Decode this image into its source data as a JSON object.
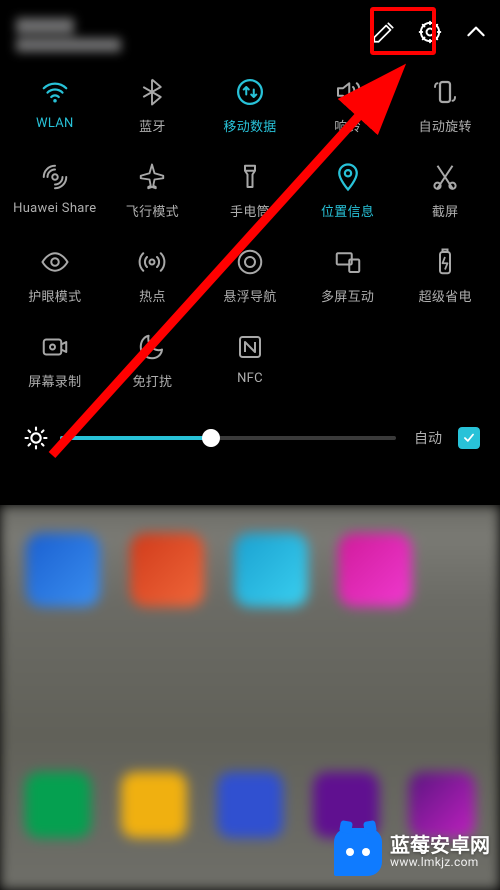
{
  "header": {
    "edit_icon": "edit-icon",
    "settings_icon": "gear-icon",
    "collapse_icon": "chevron-up-icon"
  },
  "tiles": [
    {
      "id": "wlan",
      "label": "WLAN",
      "icon": "wifi-icon",
      "active": true
    },
    {
      "id": "bluetooth",
      "label": "蓝牙",
      "icon": "bluetooth-icon",
      "active": false
    },
    {
      "id": "mobile-data",
      "label": "移动数据",
      "icon": "mobile-data-icon",
      "active": true
    },
    {
      "id": "sound",
      "label": "响铃",
      "icon": "sound-icon",
      "active": false
    },
    {
      "id": "auto-rotate",
      "label": "自动旋转",
      "icon": "auto-rotate-icon",
      "active": false
    },
    {
      "id": "huawei-share",
      "label": "Huawei Share",
      "icon": "huawei-share-icon",
      "active": false
    },
    {
      "id": "airplane",
      "label": "飞行模式",
      "icon": "airplane-icon",
      "active": false
    },
    {
      "id": "flashlight",
      "label": "手电筒",
      "icon": "flashlight-icon",
      "active": false
    },
    {
      "id": "location",
      "label": "位置信息",
      "icon": "location-icon",
      "active": true
    },
    {
      "id": "screenshot",
      "label": "截屏",
      "icon": "screenshot-icon",
      "active": false
    },
    {
      "id": "eye-comfort",
      "label": "护眼模式",
      "icon": "eye-comfort-icon",
      "active": false
    },
    {
      "id": "hotspot",
      "label": "热点",
      "icon": "hotspot-icon",
      "active": false
    },
    {
      "id": "float-nav",
      "label": "悬浮导航",
      "icon": "float-nav-icon",
      "active": false
    },
    {
      "id": "multi-screen",
      "label": "多屏互动",
      "icon": "multi-screen-icon",
      "active": false
    },
    {
      "id": "power-save",
      "label": "超级省电",
      "icon": "battery-icon",
      "active": false
    },
    {
      "id": "screen-record",
      "label": "屏幕录制",
      "icon": "screen-record-icon",
      "active": false
    },
    {
      "id": "dnd",
      "label": "免打扰",
      "icon": "do-not-disturb-icon",
      "active": false
    },
    {
      "id": "nfc",
      "label": "NFC",
      "icon": "nfc-icon",
      "active": false
    }
  ],
  "brightness": {
    "value_percent": 45,
    "auto_label": "自动",
    "auto_checked": true
  },
  "annotation": {
    "highlight_target": "settings-button",
    "arrow_color": "#ff0000"
  },
  "watermark": {
    "title": "蓝莓安卓网",
    "url": "www.lmkjz.com"
  }
}
